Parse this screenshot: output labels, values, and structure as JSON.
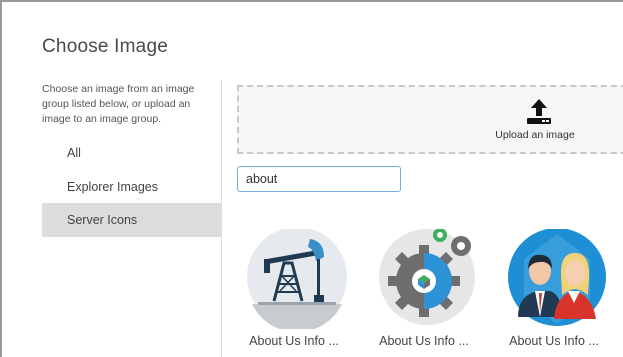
{
  "dialog": {
    "title": "Choose Image",
    "description": "Choose an image from an image group listed below, or upload an image to an image group."
  },
  "sidebar": {
    "items": [
      {
        "label": "All",
        "active": false
      },
      {
        "label": "Explorer Images",
        "active": false
      },
      {
        "label": "Server Icons",
        "active": true
      }
    ]
  },
  "upload": {
    "label": "Upload an image",
    "icon": "upload-icon"
  },
  "search": {
    "value": "about"
  },
  "results": [
    {
      "label": "About Us Info ...",
      "icon": "oil-pump-icon"
    },
    {
      "label": "About Us Info ...",
      "icon": "gears-icon"
    },
    {
      "label": "About Us Info ...",
      "icon": "people-icon"
    }
  ],
  "colors": {
    "accent": "#1e8fd5",
    "active_bg": "#dcdcdc",
    "search_border": "#7aaee0"
  }
}
